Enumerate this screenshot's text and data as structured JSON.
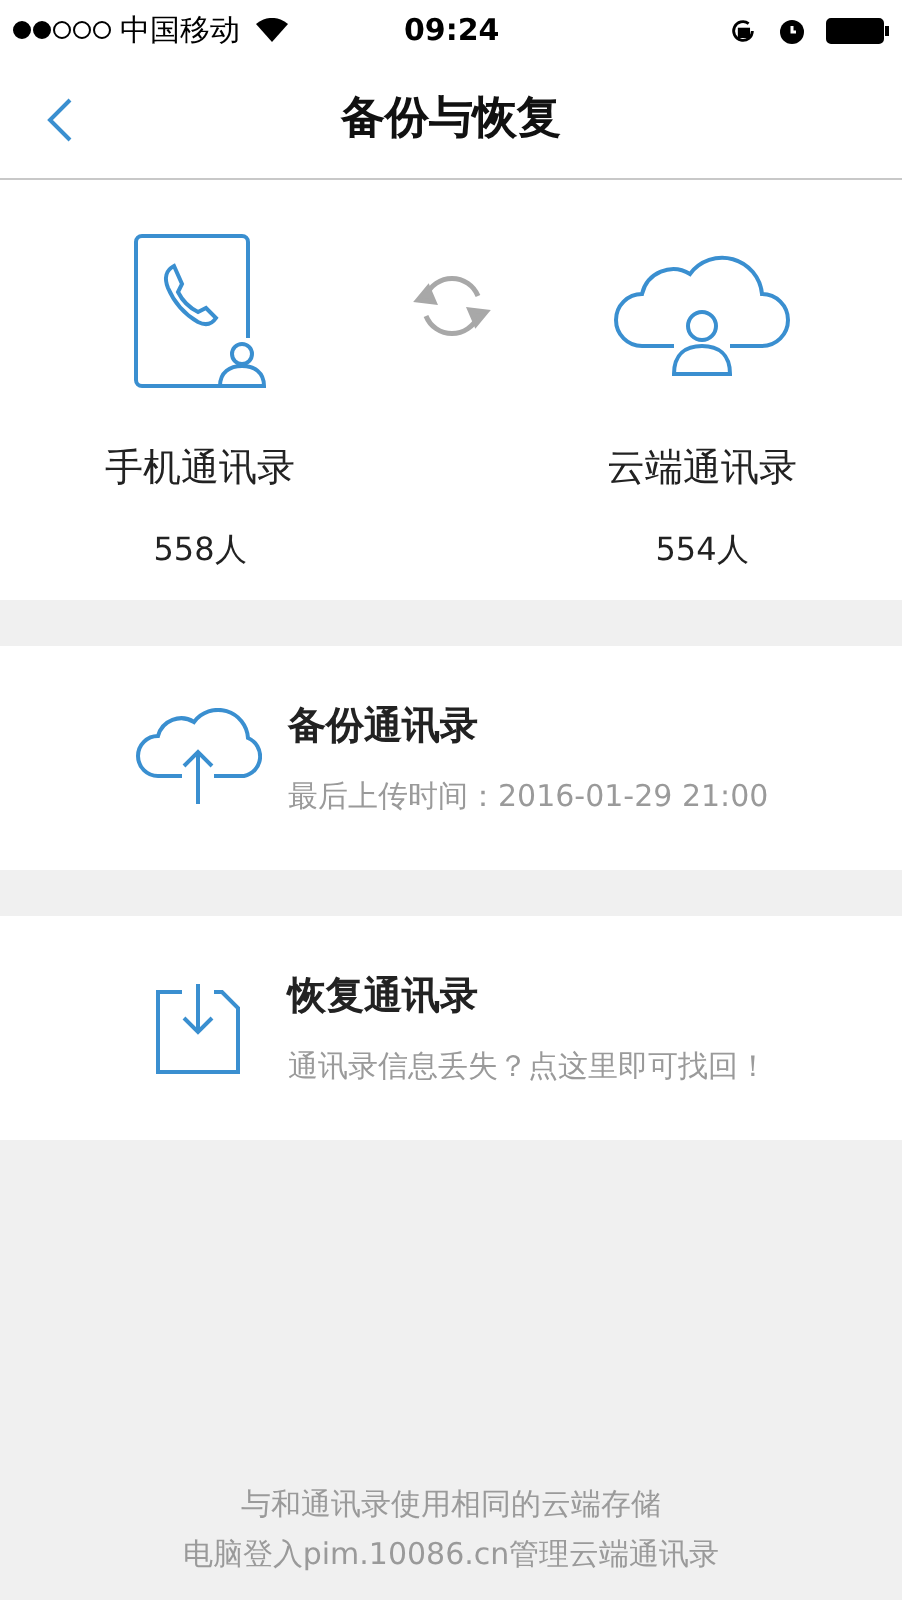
{
  "status_bar": {
    "carrier": "中国移动",
    "time": "09:24"
  },
  "nav": {
    "title": "备份与恢复"
  },
  "summary": [
    {
      "kind": "phone",
      "label": "手机通讯录",
      "count": "558人"
    },
    {
      "kind": "cloud",
      "label": "云端通讯录",
      "count": "554人"
    }
  ],
  "actions": [
    {
      "kind": "upload",
      "title": "备份通讯录",
      "subtitle": "最后上传时间：2016-01-29 21:00"
    },
    {
      "kind": "download",
      "title": "恢复通讯录",
      "subtitle": "通讯录信息丢失？点这里即可找回！"
    }
  ],
  "footer": [
    "与和通讯录使用相同的云端存储",
    "电脑登入pim.10086.cn管理云端通讯录"
  ]
}
